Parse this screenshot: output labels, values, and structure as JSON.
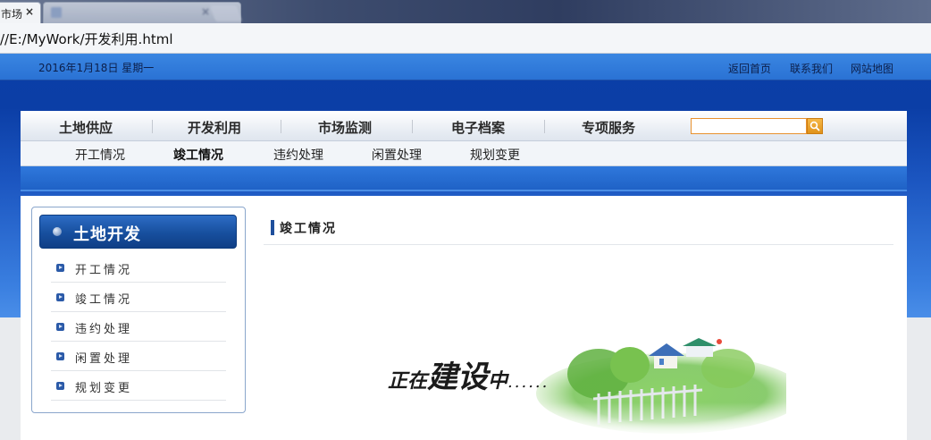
{
  "browser": {
    "tabs": [
      {
        "label": "市场",
        "close": "×"
      },
      {
        "label": "",
        "close": "×"
      }
    ],
    "address": "//E:/MyWork/开发利用.html"
  },
  "topbar": {
    "date": "2016年1月18日  星期一",
    "links": [
      "返回首页",
      "联系我们",
      "网站地图"
    ]
  },
  "nav": {
    "items": [
      "土地供应",
      "开发利用",
      "市场监测",
      "电子档案",
      "专项服务"
    ],
    "search_value": ""
  },
  "subnav": {
    "items": [
      "开工情况",
      "竣工情况",
      "违约处理",
      "闲置处理",
      "规划变更"
    ],
    "active": "竣工情况"
  },
  "sidebar": {
    "title": "土地开发",
    "items": [
      "开工情况",
      "竣工情况",
      "违约处理",
      "闲置处理",
      "规划变更"
    ]
  },
  "main": {
    "title": "竣工情况",
    "under_construction": {
      "part1": "正在",
      "part2": "建设",
      "part3": "中",
      "dots": "......"
    }
  },
  "colors": {
    "brand_blue": "#0b3ea6",
    "accent_orange": "#e0921a"
  }
}
